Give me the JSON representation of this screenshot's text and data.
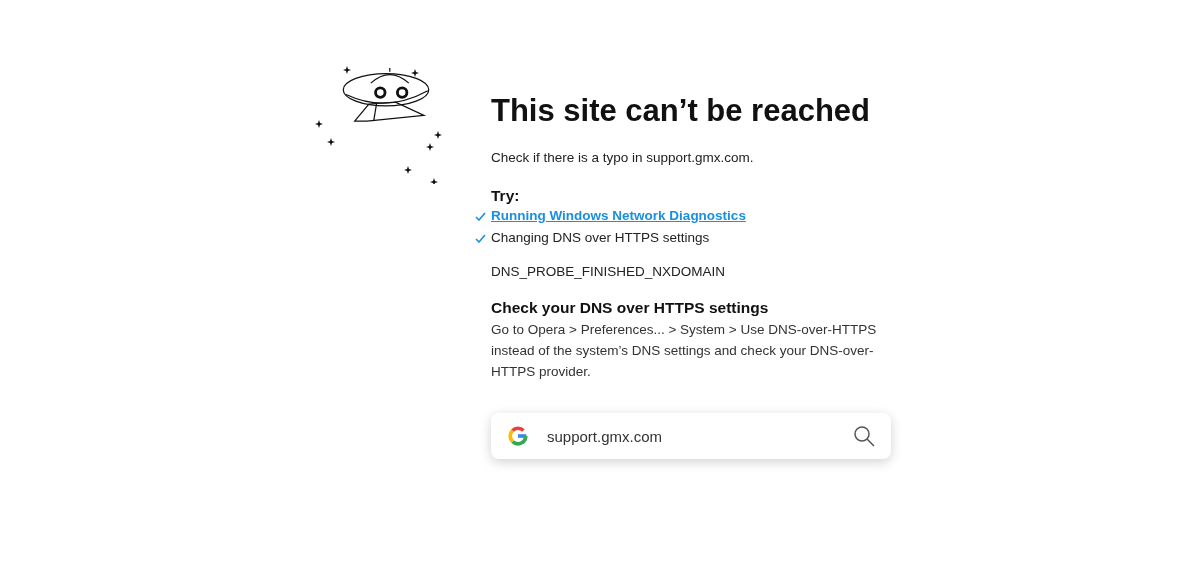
{
  "title": "This site can’t be reached",
  "message": "Check if there is a typo in support.gmx.com.",
  "try": {
    "heading": "Try:",
    "items": [
      {
        "kind": "link",
        "label": "Running Windows Network Diagnostics"
      },
      {
        "kind": "text",
        "label": "Changing DNS over HTTPS settings"
      }
    ]
  },
  "error_code": "DNS_PROBE_FINISHED_NXDOMAIN",
  "dns_section": {
    "heading": "Check your DNS over HTTPS settings",
    "body": "Go to Opera > Preferences... > System > Use DNS-over-HTTPS instead of the system’s DNS settings and check your DNS-over-HTTPS provider."
  },
  "search": {
    "value": "support.gmx.com"
  }
}
